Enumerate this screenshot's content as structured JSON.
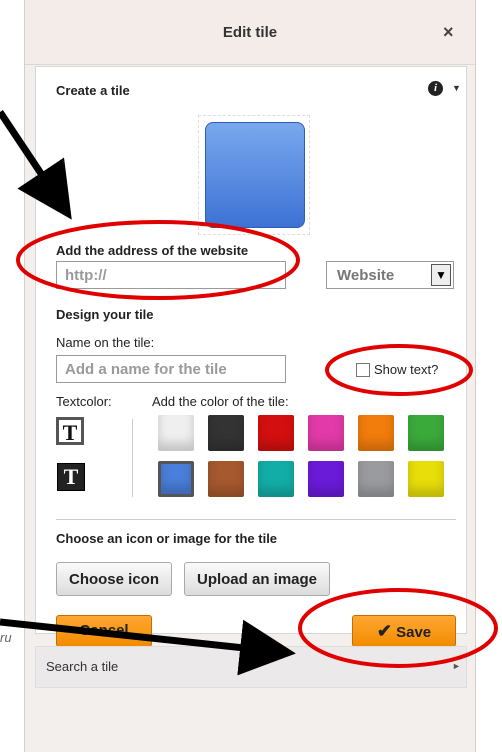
{
  "dialog": {
    "title": "Edit tile",
    "close_symbol": "×"
  },
  "create": {
    "section_title": "Create a tile",
    "info_symbol": "i",
    "address_label": "Add the address of the website",
    "address_placeholder": "http://",
    "type_select": "Website",
    "design_label": "Design your tile",
    "name_label": "Name on the tile:",
    "name_placeholder": "Add a name for the tile",
    "show_text_label": "Show text?",
    "textcolor_label": "Textcolor:",
    "tile_color_label": "Add the color of the tile:",
    "textcolor_glyph": "T",
    "swatches_row1": [
      "#f0efef",
      "#333333",
      "#d40f0f",
      "#e23aa8",
      "#f27c0c",
      "#3aab3a"
    ],
    "swatches_row2": [
      "#4a7fdb",
      "#a6582e",
      "#13ada7",
      "#6a1bd8",
      "#9a9b9f",
      "#e8de0a"
    ],
    "icon_section_label": "Choose an icon or image for the tile",
    "choose_icon": "Choose icon",
    "upload_image": "Upload an image",
    "cancel": "Cancel",
    "save": "Save"
  },
  "search": {
    "label": "Search a tile"
  },
  "background_text": "ru"
}
